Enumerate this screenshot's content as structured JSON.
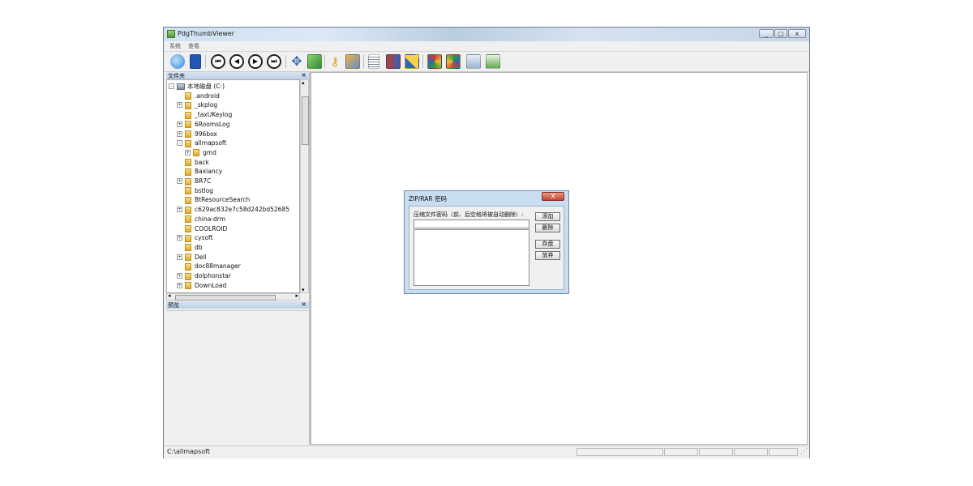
{
  "window": {
    "title": "PdgThumbViewer"
  },
  "menu": {
    "items": [
      "系统",
      "查看"
    ]
  },
  "toolbar": {
    "icons": [
      "thumbnail-viewer-icon",
      "help-book-icon",
      "first-page-icon",
      "previous-page-icon",
      "next-page-icon",
      "last-page-icon",
      "move-arrows-icon",
      "refresh-icon",
      "key-icon",
      "tools-icon",
      "document-icon",
      "book-icon",
      "chart-icon",
      "colorful-grid-icon",
      "colorful-grid-x-icon",
      "checklist-icon",
      "delete-checklist-icon"
    ],
    "nav_glyphs": [
      "⏮",
      "◀",
      "▶",
      "⏭"
    ]
  },
  "folder_pane": {
    "title": "文件夹",
    "close": "×",
    "tree": [
      {
        "label": "本地磁盘 (C:)",
        "level": 0,
        "expander": "-",
        "drive": true
      },
      {
        "label": ".android",
        "level": 1,
        "expander": ""
      },
      {
        "label": "_skplog",
        "level": 1,
        "expander": "+"
      },
      {
        "label": "_taxUKeylog",
        "level": 1,
        "expander": ""
      },
      {
        "label": "6RoomsLog",
        "level": 1,
        "expander": "+"
      },
      {
        "label": "996box",
        "level": 1,
        "expander": "+"
      },
      {
        "label": "allmapsoft",
        "level": 1,
        "expander": "-"
      },
      {
        "label": "gmd",
        "level": 2,
        "expander": "+"
      },
      {
        "label": "back",
        "level": 1,
        "expander": ""
      },
      {
        "label": "Baxiancy",
        "level": 1,
        "expander": ""
      },
      {
        "label": "BR7C",
        "level": 1,
        "expander": "+"
      },
      {
        "label": "bstlog",
        "level": 1,
        "expander": ""
      },
      {
        "label": "BtResourceSearch",
        "level": 1,
        "expander": ""
      },
      {
        "label": "c629ac832e7c58d242bd52685",
        "level": 1,
        "expander": "+"
      },
      {
        "label": "china-drm",
        "level": 1,
        "expander": ""
      },
      {
        "label": "COOLROID",
        "level": 1,
        "expander": ""
      },
      {
        "label": "cysoft",
        "level": 1,
        "expander": "+"
      },
      {
        "label": "db",
        "level": 1,
        "expander": ""
      },
      {
        "label": "Dell",
        "level": 1,
        "expander": "+"
      },
      {
        "label": "doc88manager",
        "level": 1,
        "expander": ""
      },
      {
        "label": "dolphonstar",
        "level": 1,
        "expander": "+"
      },
      {
        "label": "DownLoad",
        "level": 1,
        "expander": "+"
      }
    ],
    "scroll_up": "▴",
    "scroll_down": "▾",
    "scroll_left": "◂",
    "scroll_right": "▸"
  },
  "preview_pane": {
    "title": "预览",
    "close": "×"
  },
  "status": {
    "path": "C:\\allmapsoft"
  },
  "dialog": {
    "title": "ZIP/RAR 密码",
    "close": "X",
    "label": "压缩文件密码（前、后空格将被自动删除）:",
    "input_value": "",
    "buttons": {
      "add": "添加",
      "delete": "删除",
      "save": "存盘",
      "discard": "放弃"
    }
  },
  "colors": {
    "title_blue": "#cfe0f2",
    "pane_head": "#c8daee",
    "close_red": "#c4432e"
  }
}
